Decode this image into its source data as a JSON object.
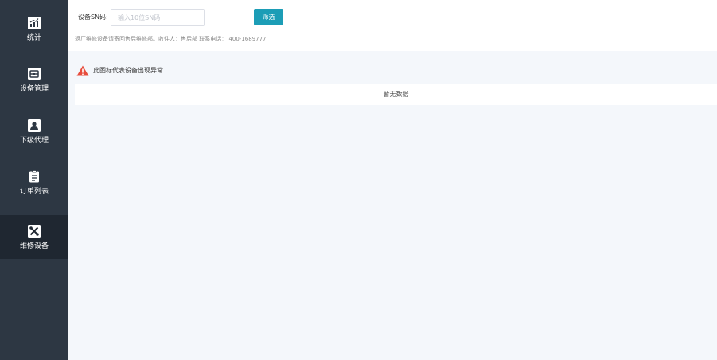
{
  "sidebar": {
    "items": [
      {
        "label": "统计",
        "icon": "bar-chart-icon",
        "active": false
      },
      {
        "label": "设备管理",
        "icon": "device-box-icon",
        "active": false
      },
      {
        "label": "下级代理",
        "icon": "agent-user-icon",
        "active": false
      },
      {
        "label": "订单列表",
        "icon": "clipboard-icon",
        "active": false
      },
      {
        "label": "维修设备",
        "icon": "tools-icon",
        "active": true
      }
    ]
  },
  "filter": {
    "sn_label": "设备SN码:",
    "sn_placeholder": "输入10位SN码",
    "sn_value": "",
    "button_label": "筛选"
  },
  "notice": "返厂维修设备请寄回售后维修部。收件人：售后部 联系电话： 400-1689777",
  "legend": {
    "text": "此图标代表设备出现异常",
    "icon": "warning-icon",
    "icon_color": "#e74c3c"
  },
  "table": {
    "empty_text": "暂无数据"
  },
  "colors": {
    "sidebar_bg": "#2d3743",
    "sidebar_active_bg": "#1f2731",
    "accent": "#1c9db6",
    "content_bg": "#f4f7fb"
  }
}
